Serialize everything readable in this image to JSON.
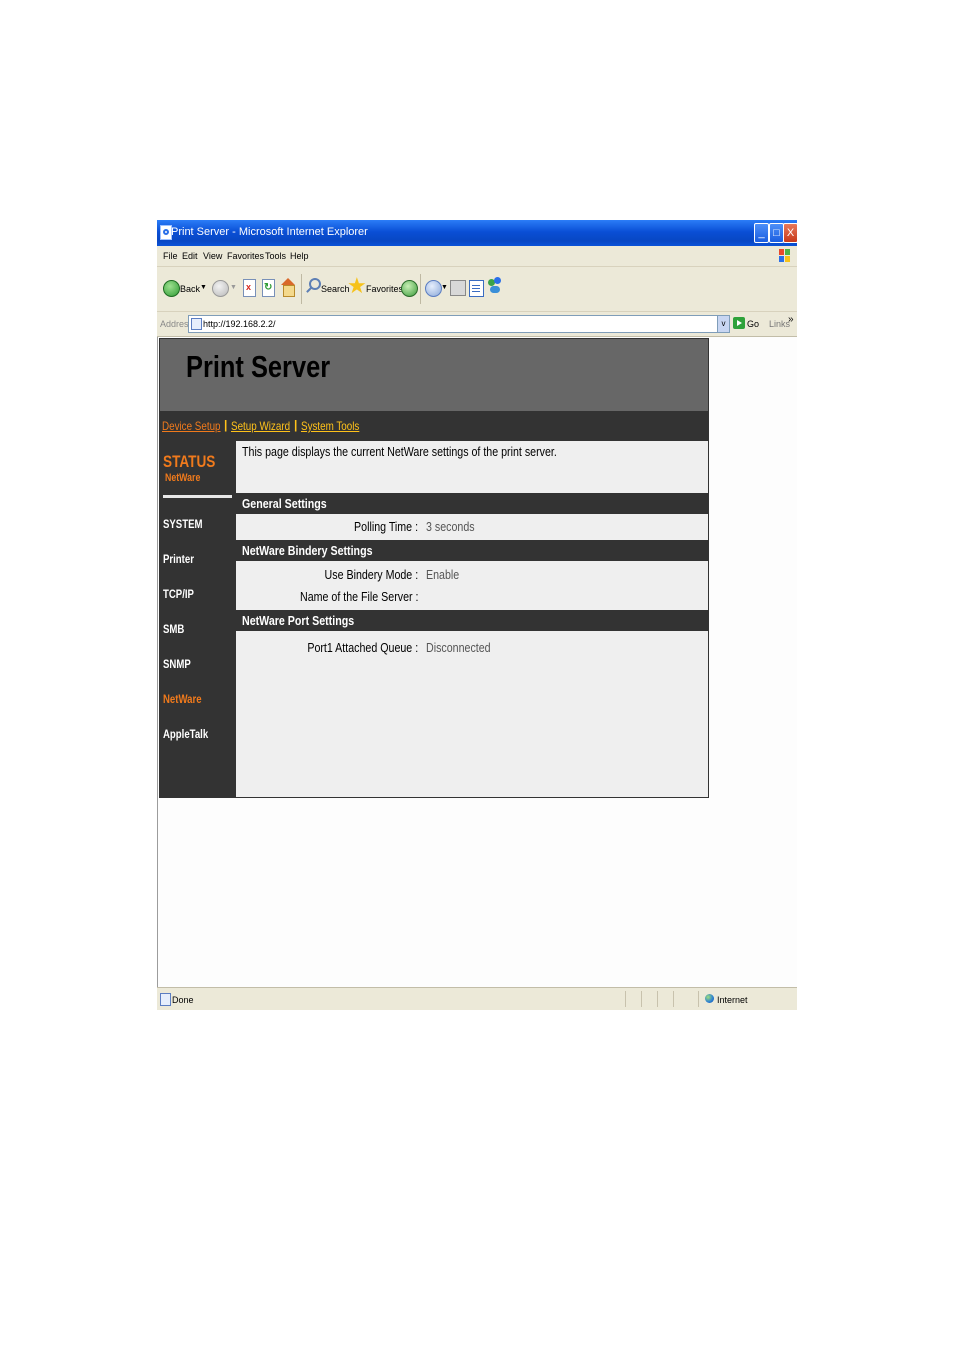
{
  "window": {
    "title": "Print Server - Microsoft Internet Explorer",
    "controls": {
      "minimize": "_",
      "maximize": "□",
      "close": "X"
    }
  },
  "menu": [
    "File",
    "Edit",
    "View",
    "Favorites",
    "Tools",
    "Help"
  ],
  "toolbar": {
    "back_label": "Back",
    "search_label": "Search",
    "favorites_label": "Favorites"
  },
  "address": {
    "label": "Address",
    "url": "http://192.168.2.2/",
    "go_label": "Go",
    "links_label": "Links",
    "more": "»"
  },
  "page": {
    "banner_title": "Print Server",
    "top_nav": [
      "Device Setup",
      "Setup Wizard",
      "System Tools"
    ],
    "nav_separator": "|",
    "sidebar": {
      "section_title": "STATUS",
      "section_subtitle": "NetWare",
      "items": [
        "SYSTEM",
        "Printer",
        "TCP/IP",
        "SMB",
        "SNMP",
        "NetWare",
        "AppleTalk"
      ],
      "active_item": "NetWare"
    },
    "intro": "This page displays the current NetWare settings of the print server.",
    "sections": [
      {
        "title": "General Settings",
        "rows": [
          {
            "label": "Polling Time :",
            "value": "3 seconds"
          }
        ]
      },
      {
        "title": "NetWare Bindery Settings",
        "rows": [
          {
            "label": "Use Bindery Mode :",
            "value": "Enable"
          },
          {
            "label": "Name of the File Server :",
            "value": ""
          }
        ]
      },
      {
        "title": "NetWare Port Settings",
        "rows": [
          {
            "label": "Port1 Attached Queue :",
            "value": "Disconnected"
          }
        ]
      }
    ]
  },
  "statusbar": {
    "text": "Done",
    "zone": "Internet"
  },
  "colors": {
    "accent_orange": "#f07a1c",
    "link_yellow": "#ffc21a",
    "panel_dark": "#333333",
    "banner_gray": "#676767"
  }
}
